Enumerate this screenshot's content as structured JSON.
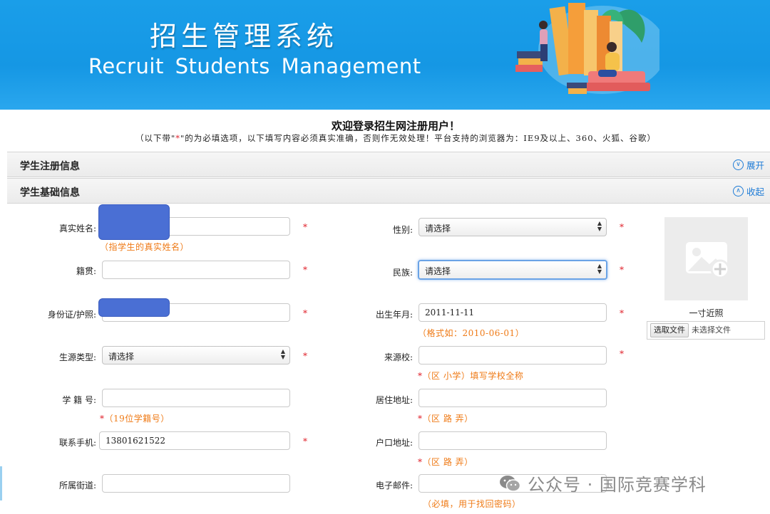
{
  "banner": {
    "title_cn": "招生管理系统",
    "title_en": "Recruit Students  Management"
  },
  "welcome": {
    "title": "欢迎登录招生网注册用户！",
    "notice_prefix": "（以下带\"",
    "notice_star": "*",
    "notice_suffix": "\"的为必填选项，以下填写内容必须真实准确，否则作无效处理！平台支持的浏览器为：IE9及以上、360、火狐、谷歌）"
  },
  "sections": {
    "registration": {
      "label": "学生注册信息",
      "toggle_label": "展开",
      "toggle_icon": "chevron-down-icon"
    },
    "basic": {
      "label": "学生基础信息",
      "toggle_label": "收起",
      "toggle_icon": "chevron-up-icon"
    }
  },
  "form": {
    "required_mark": "*",
    "real_name": {
      "label": "真实姓名:",
      "value": "",
      "hint": "（指学生的真实姓名）"
    },
    "gender": {
      "label": "性别:",
      "value": "请选择"
    },
    "native_place": {
      "label": "籍贯:",
      "value": ""
    },
    "ethnicity": {
      "label": "民族:",
      "value": "请选择"
    },
    "id_card": {
      "label": "身份证/护照:",
      "value": ""
    },
    "birth_date": {
      "label": "出生年月:",
      "value": "2011-11-11",
      "hint": "（格式如：2010-06-01）"
    },
    "source_type": {
      "label": "生源类型:",
      "value": "请选择"
    },
    "source_school": {
      "label": "来源校:",
      "value": "",
      "hint": "（区 小学）填写学校全称"
    },
    "student_no": {
      "label": "学 籍 号:",
      "value": "",
      "hint": "（19位学籍号）"
    },
    "residence": {
      "label": "居住地址:",
      "value": "",
      "hint": "（区 路 弄）"
    },
    "phone": {
      "label": "联系手机:",
      "value": "13801621522"
    },
    "hukou": {
      "label": "户口地址:",
      "value": "",
      "hint": "（区 路 弄）"
    },
    "street": {
      "label": "所属街道:",
      "value": ""
    },
    "email": {
      "label": "电子邮件:",
      "value": "",
      "hint": "（必填，用于找回密码）"
    }
  },
  "photo": {
    "caption": "一寸近照",
    "file_button": "选取文件",
    "file_status": "未选择文件",
    "icon": "image-add-icon"
  },
  "watermark": {
    "text": "公众号 · 国际竞赛学科",
    "icon": "wechat-icon"
  },
  "colors": {
    "banner_blue": "#1597e4",
    "required_red": "#e0202a",
    "hint_orange": "#ef7a16",
    "link_blue": "#1d7bd6",
    "redaction_blue": "#4a6fd4"
  }
}
